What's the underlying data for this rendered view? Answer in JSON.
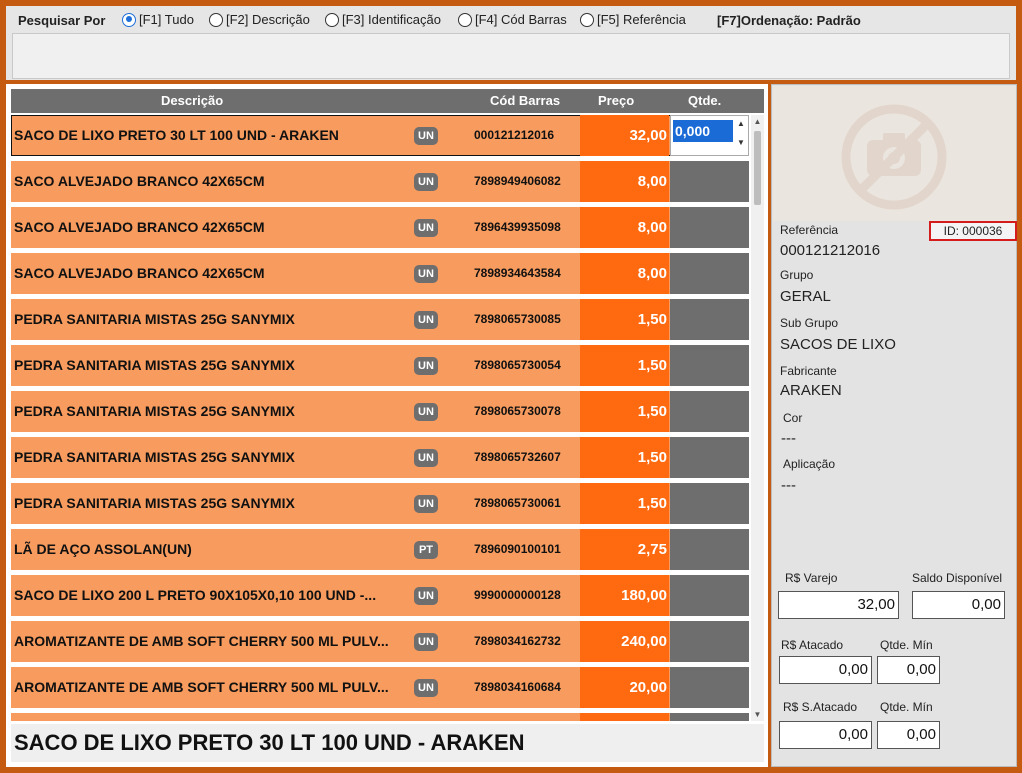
{
  "search": {
    "label": "Pesquisar Por",
    "options": [
      {
        "label": "[F1] Tudo",
        "checked": true
      },
      {
        "label": "[F2] Descrição",
        "checked": false
      },
      {
        "label": "[F3] Identificação",
        "checked": false
      },
      {
        "label": "[F4] Cód Barras",
        "checked": false
      },
      {
        "label": "[F5] Referência",
        "checked": false
      }
    ],
    "sort_label": "[F7]Ordenação: Padrão",
    "query": ""
  },
  "grid": {
    "columns": {
      "description": "Descrição",
      "barcode": "Cód Barras",
      "price": "Preço",
      "qty": "Qtde."
    },
    "rows": [
      {
        "description": "SACO DE LIXO PRETO 30 LT 100 UND - ARAKEN",
        "unit": "UN",
        "barcode": "000121212016",
        "price": "32,00",
        "qty": "0,000",
        "selected": true
      },
      {
        "description": "SACO ALVEJADO BRANCO 42X65CM",
        "unit": "UN",
        "barcode": "7898949406082",
        "price": "8,00"
      },
      {
        "description": "SACO ALVEJADO BRANCO 42X65CM",
        "unit": "UN",
        "barcode": "7896439935098",
        "price": "8,00"
      },
      {
        "description": "SACO ALVEJADO BRANCO 42X65CM",
        "unit": "UN",
        "barcode": "7898934643584",
        "price": "8,00"
      },
      {
        "description": "PEDRA SANITARIA MISTAS 25G SANYMIX",
        "unit": "UN",
        "barcode": "7898065730085",
        "price": "1,50"
      },
      {
        "description": "PEDRA SANITARIA MISTAS 25G SANYMIX",
        "unit": "UN",
        "barcode": "7898065730054",
        "price": "1,50"
      },
      {
        "description": "PEDRA SANITARIA MISTAS 25G SANYMIX",
        "unit": "UN",
        "barcode": "7898065730078",
        "price": "1,50"
      },
      {
        "description": "PEDRA SANITARIA MISTAS 25G SANYMIX",
        "unit": "UN",
        "barcode": "7898065732607",
        "price": "1,50"
      },
      {
        "description": "PEDRA SANITARIA MISTAS 25G SANYMIX",
        "unit": "UN",
        "barcode": "7898065730061",
        "price": "1,50"
      },
      {
        "description": "LÃ DE AÇO ASSOLAN(UN)",
        "unit": "PT",
        "barcode": "7896090100101",
        "price": "2,75"
      },
      {
        "description": "SACO DE LIXO 200 L PRETO 90X105X0,10 100 UND -...",
        "unit": "UN",
        "barcode": "9990000000128",
        "price": "180,00"
      },
      {
        "description": "AROMATIZANTE DE AMB SOFT CHERRY 500 ML PULV...",
        "unit": "UN",
        "barcode": "7898034162732",
        "price": "240,00"
      },
      {
        "description": "AROMATIZANTE DE AMB SOFT CHERRY 500 ML PULV...",
        "unit": "UN",
        "barcode": "7898034160684",
        "price": "20,00"
      }
    ],
    "selected_description": "SACO DE LIXO PRETO 30 LT 100 UND - ARAKEN"
  },
  "detail": {
    "reference_label": "Referência",
    "reference": "000121212016",
    "id": "ID: 000036",
    "group_label": "Grupo",
    "group": "GERAL",
    "subgroup_label": "Sub Grupo",
    "subgroup": "SACOS DE LIXO",
    "manufacturer_label": "Fabricante",
    "manufacturer": "ARAKEN",
    "color_label": "Cor",
    "color": "---",
    "application_label": "Aplicação",
    "application": "---",
    "retail_label": "R$ Varejo",
    "retail": "32,00",
    "stock_label": "Saldo Disponível",
    "stock": "0,00",
    "wholesale_label": "R$ Atacado",
    "wholesale": "0,00",
    "wholesale_min_label": "Qtde. Mín",
    "wholesale_min": "0,00",
    "superwholesale_label": "R$ S.Atacado",
    "superwholesale": "0,00",
    "superwholesale_min_label": "Qtde. Mín",
    "superwholesale_min": "0,00"
  },
  "colors": {
    "accent": "#c55a11",
    "row": "#f79b5e",
    "price": "#ff6a10",
    "header": "#6e6e6e",
    "selection": "#1a6bd6",
    "id_border": "#d41c1c"
  },
  "icons": {
    "photo_placeholder": "no-camera-icon"
  }
}
